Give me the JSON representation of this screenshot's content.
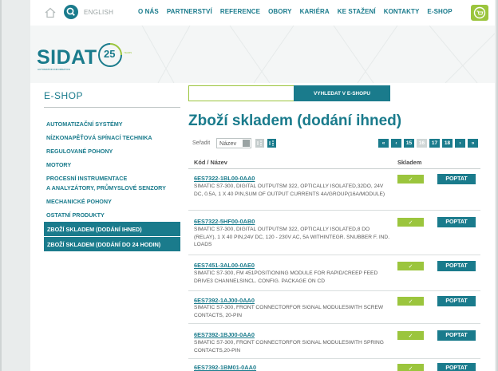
{
  "nav": {
    "language": "ENGLISH",
    "items": [
      "O NÁS",
      "PARTNERSTVÍ",
      "REFERENCE",
      "OBORY",
      "KARIÉRA",
      "KE STAŽENÍ",
      "KONTAKTY",
      "E-SHOP"
    ]
  },
  "logo": {
    "brand": "SIDAT",
    "tagline": "AUTOMATION INFORMATICS",
    "years_number": "25",
    "years_label": "YEARS"
  },
  "sidebar": {
    "title": "E-SHOP",
    "items": [
      {
        "label": "AUTOMATIZAČNÍ SYSTÉMY"
      },
      {
        "label": "NÍZKONAPĚŤOVÁ SPÍNACÍ TECHNIKA"
      },
      {
        "label": "REGULOVANÉ POHONY"
      },
      {
        "label": "MOTORY"
      },
      {
        "label": "PROCESNÍ INSTRUMENTACE",
        "label2": "A ANALYZÁTORY, PRŮMYSLOVÉ SENZORY"
      },
      {
        "label": "MECHANICKÉ POHONY"
      },
      {
        "label": "OSTATNÍ PRODUKTY"
      },
      {
        "label": "ZBOŽÍ SKLADEM (DODÁNÍ IHNED)"
      },
      {
        "label": "ZBOŽÍ SKLADEM (DODÁNÍ DO 24 HODIN)"
      }
    ]
  },
  "search": {
    "placeholder": "",
    "button": "VYHLEDAT V E-SHOPU"
  },
  "main": {
    "heading": "Zboží skladem (dodání ihned)",
    "sort_label": "Seřadit",
    "sort_value": "Název",
    "pager": [
      "«",
      "‹",
      "15",
      "16",
      "17",
      "18",
      "›",
      "»"
    ],
    "pager_current": "16",
    "columns": {
      "code": "Kód / Název",
      "stock": "Skladem"
    },
    "stock_mark": "✓",
    "ask_label": "POPTAT",
    "rows": [
      {
        "code": "6ES7322-1BL00-0AA0",
        "desc": "SIMATIC S7-300, DIGITAL OUTPUTSM 322, OPTICALLY ISOLATED,32DO, 24V DC, 0.5A, 1 X 40 PIN,SUM OF OUTPUT CURRENTS 4A/GROUP(16A/MODULE)"
      },
      {
        "code": "6ES7322-5HF00-0AB0",
        "desc": "SIMATIC S7-300, DIGITAL OUTPUTSM 322, OPTICALLY ISOLATED,8 DO (RELAY), 1 X 40 PIN,24V DC, 120 - 230V AC, 5A WITHINTEGR. SNUBBER F. IND. LOADS"
      },
      {
        "code": "6ES7451-3AL00-0AE0",
        "desc": "SIMATIC S7-300, FM 451POSITIONING MODULE FOR RAPID/CREEP FEED DRIVE3 CHANNELSINCL. CONFIG. PACKAGE ON CD"
      },
      {
        "code": "6ES7392-1AJ00-0AA0",
        "desc": "SIMATIC S7-300, FRONT CONNECTORFOR SIGNAL MODULESWITH SCREW CONTACTS, 20-PIN"
      },
      {
        "code": "6ES7392-1BJ00-0AA0",
        "desc": "SIMATIC S7-300, FRONT CONNECTORFOR SIGNAL MODULESWITH SPRING CONTACTS,20-PIN"
      },
      {
        "code": "6ES7392-1BM01-0AA0",
        "desc": ""
      }
    ]
  }
}
